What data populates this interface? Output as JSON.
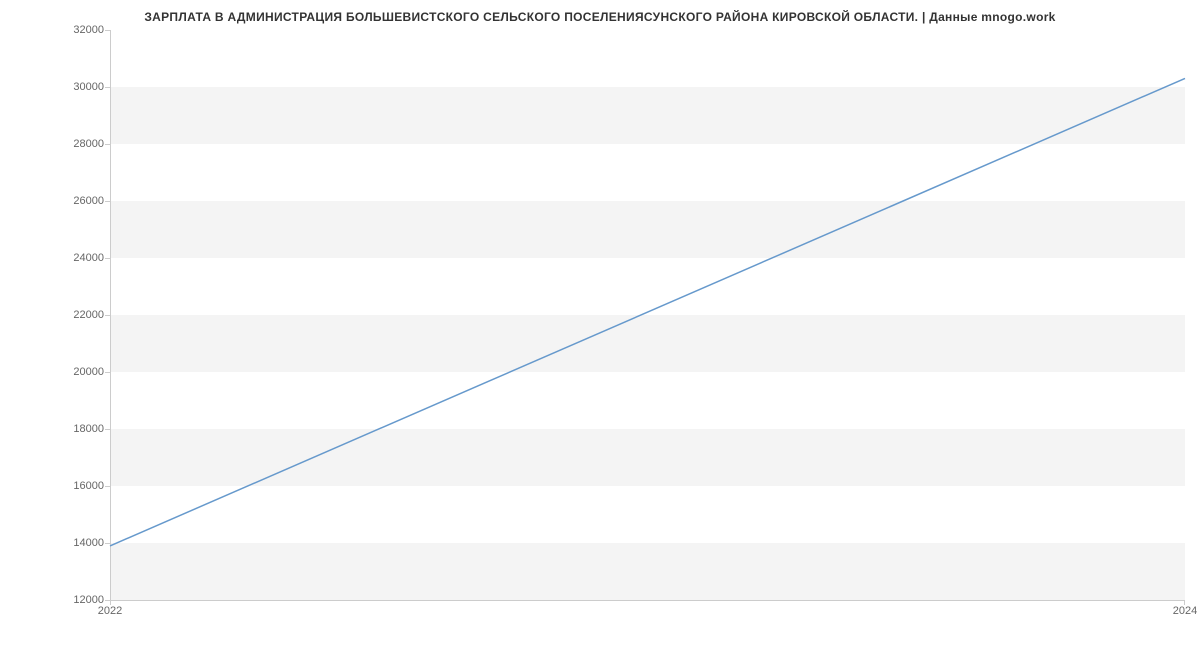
{
  "chart_data": {
    "type": "line",
    "title": "ЗАРПЛАТА В АДМИНИСТРАЦИЯ БОЛЬШЕВИСТСКОГО СЕЛЬСКОГО ПОСЕЛЕНИЯСУНСКОГО РАЙОНА КИРОВСКОЙ ОБЛАСТИ. | Данные mnogo.work",
    "x": [
      2022,
      2024
    ],
    "values": [
      13900,
      30300
    ],
    "xlabel": "",
    "ylabel": "",
    "xlim": [
      2022,
      2024
    ],
    "ylim": [
      12000,
      32000
    ],
    "x_ticks": [
      2022,
      2024
    ],
    "y_ticks": [
      12000,
      14000,
      16000,
      18000,
      20000,
      22000,
      24000,
      26000,
      28000,
      30000,
      32000
    ],
    "line_color": "#6699cc"
  }
}
